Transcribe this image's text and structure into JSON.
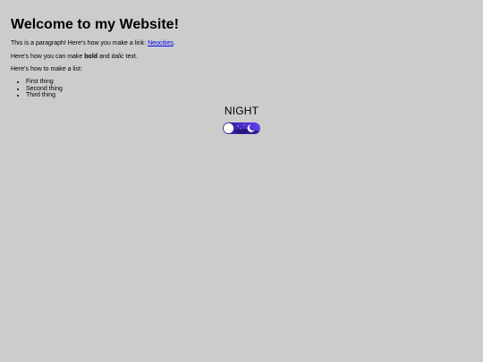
{
  "page": {
    "title": "Welcome to my Website!",
    "paragraph1": {
      "before": "This is a paragraph! Here's how you make a link: ",
      "link_text": "Neocities",
      "after": "."
    },
    "paragraph2": {
      "before": "Here's how you can make ",
      "bold": "bold",
      "middle": " and ",
      "italic": "italic",
      "after": " text."
    },
    "paragraph3": "Here's how to make a list:",
    "list_items": [
      "First thing",
      "Second thing",
      "Third thing"
    ]
  },
  "theme_toggle": {
    "label": "NIGHT",
    "state": "night"
  },
  "colors": {
    "background": "#cccccc",
    "link": "#0000ee",
    "toggle_track": "#4a2ec9",
    "toggle_knob": "#ffffff"
  }
}
